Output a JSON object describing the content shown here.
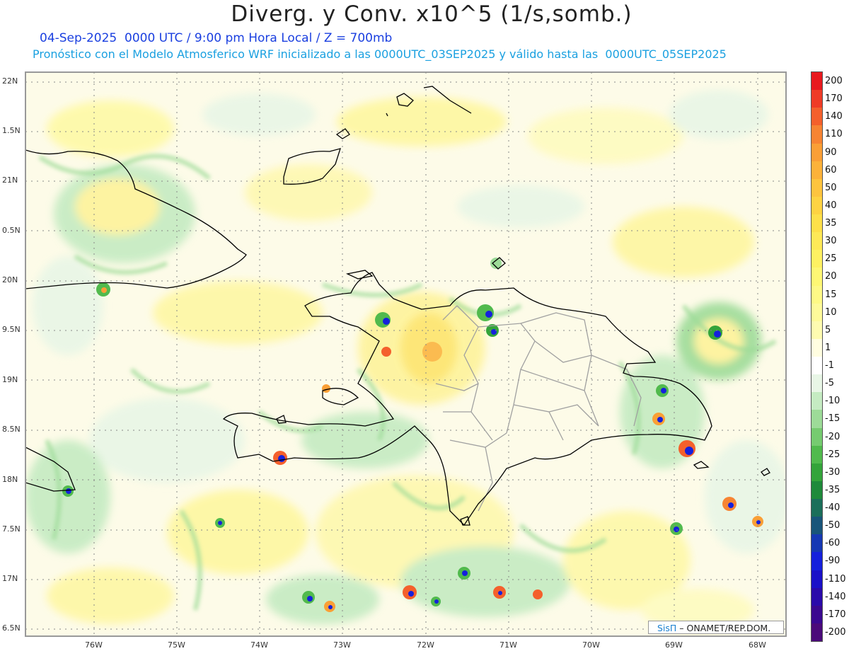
{
  "header": {
    "title": "Diverg. y Conv. x10^5 (1/s,somb.)",
    "line1": "04-Sep-2025  0000 UTC / 9:00 pm Hora Local / Z = 700mb",
    "line2": "Pronóstico con el Modelo Atmosferico WRF inicializado a las 0000UTC_03SEP2025 y válido hasta las  0000UTC_05SEP2025"
  },
  "axes": {
    "lat_labels": [
      "22N",
      "1.5N",
      "21N",
      "0.5N",
      "20N",
      "9.5N",
      "19N",
      "8.5N",
      "18N",
      "7.5N",
      "17N",
      "6.5N"
    ],
    "lon_labels": [
      "76W",
      "75W",
      "74W",
      "73W",
      "72W",
      "71W",
      "70W",
      "69W",
      "68W"
    ]
  },
  "colorbar": {
    "labels": [
      "200",
      "170",
      "140",
      "110",
      "90",
      "60",
      "50",
      "40",
      "35",
      "30",
      "25",
      "20",
      "15",
      "10",
      "5",
      "1",
      "-1",
      "-5",
      "-10",
      "-15",
      "-20",
      "-25",
      "-30",
      "-35",
      "-40",
      "-50",
      "-60",
      "-90",
      "-110",
      "-140",
      "-170",
      "-200"
    ],
    "colors": [
      "#e8191e",
      "#ef3b26",
      "#f4602c",
      "#f78433",
      "#fa9f36",
      "#fcb23a",
      "#fdc43e",
      "#fed342",
      "#fee04a",
      "#fee957",
      "#fef162",
      "#fef774",
      "#fef986",
      "#fefa9a",
      "#fefbb0",
      "#fffde0",
      "#ffffff",
      "#e8f6e6",
      "#c5ebc2",
      "#9ddb98",
      "#76cb70",
      "#51ba4d",
      "#34a43a",
      "#1f8a3a",
      "#1b6f5a",
      "#18557a",
      "#1638b4",
      "#1520dc",
      "#1a10c8",
      "#2a0aaa",
      "#3a0890",
      "#4b0a7a"
    ]
  },
  "credit": {
    "brand": "SisΠ",
    "text": " – ONAMET/REP.DOM."
  }
}
